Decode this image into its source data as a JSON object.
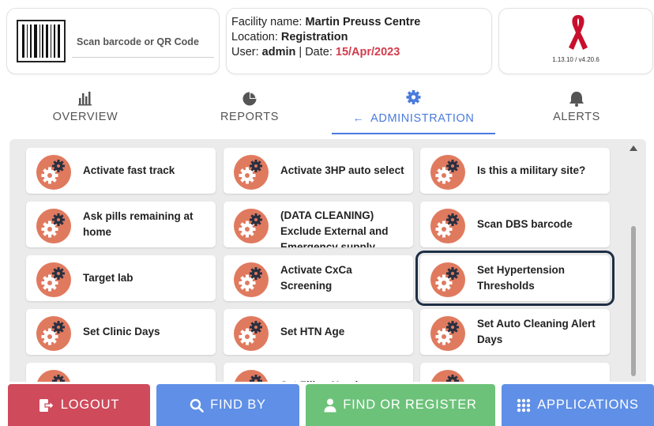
{
  "scan": {
    "placeholder": "Scan barcode or QR Code"
  },
  "facility": {
    "name_label": "Facility name: ",
    "name": "Martin Preuss Centre",
    "location_label": "Location: ",
    "location": "Registration",
    "user_label": "User: ",
    "user": "admin",
    "separator": " | Date: ",
    "date": "15/Apr/2023"
  },
  "app": {
    "version": "1.13.10 / v4.20.6",
    "accent": "#c8102e"
  },
  "tabs": [
    {
      "label": "OVERVIEW",
      "icon": "bar-chart-icon"
    },
    {
      "label": "REPORTS",
      "icon": "pie-chart-icon"
    },
    {
      "label": "ADMINISTRATION",
      "icon": "gear-icon",
      "active": true
    },
    {
      "label": "ALERTS",
      "icon": "bell-icon"
    }
  ],
  "tiles": [
    {
      "label": "Activate fast track"
    },
    {
      "label": "Activate 3HP auto select"
    },
    {
      "label": "Is this a military site?"
    },
    {
      "label": "Ask pills remaining at home"
    },
    {
      "label": "(DATA CLEANING) Exclude External and Emergency supply"
    },
    {
      "label": "Scan DBS barcode"
    },
    {
      "label": "Target lab"
    },
    {
      "label": "Activate CxCa Screening"
    },
    {
      "label": "Set Hypertension Thresholds",
      "selected": true
    },
    {
      "label": "Set Clinic Days"
    },
    {
      "label": "Set HTN Age"
    },
    {
      "label": "Set Auto Cleaning Alert Days"
    },
    {
      "label": ""
    },
    {
      "label": "Set Filing Numbers"
    },
    {
      "label": ""
    }
  ],
  "footer": {
    "logout": "LOGOUT",
    "find_by": "FIND BY",
    "find_register": "FIND OR REGISTER",
    "applications": "APPLICATIONS"
  },
  "colors": {
    "logout": "#cf4a5b",
    "find_by": "#5f8fe6",
    "find_register": "#6cc279",
    "applications": "#5f8fe6",
    "active_tab": "#4a7bdc",
    "date": "#d23c4b",
    "tile_icon": "#e07a5f"
  }
}
